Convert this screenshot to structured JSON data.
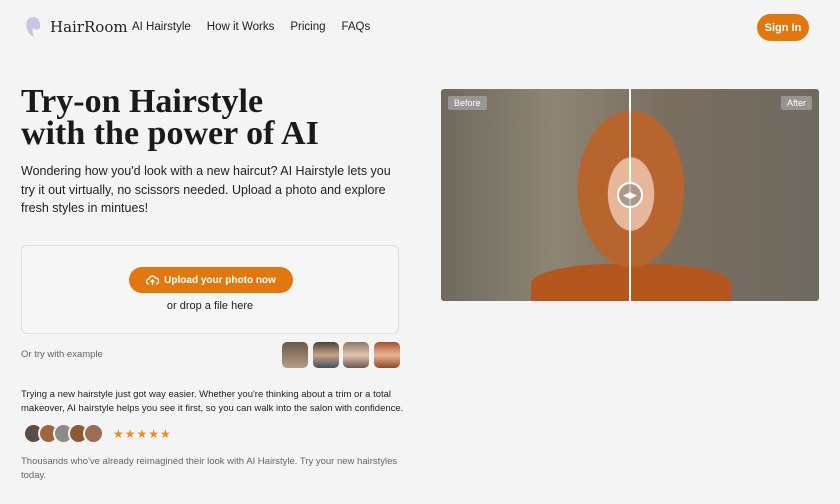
{
  "header": {
    "brand": "HairRoom",
    "nav": [
      "AI Hairstyle",
      "How it Works",
      "Pricing",
      "FAQs"
    ],
    "sign_in": "Sign In"
  },
  "hero": {
    "title_line1": "Try-on Hairstyle",
    "title_line2": "with the power of AI",
    "description": "Wondering how you'd look with a new haircut? AI Hairstyle lets you try it out virtually, no scissors needed. Upload a photo and explore fresh styles in mintues!"
  },
  "upload": {
    "button": "Upload your photo now",
    "drop": "or drop a file here"
  },
  "examples": {
    "label": "Or try with example",
    "count": 4
  },
  "body_text": "Trying a new hairstyle just got way easier. Whether you're thinking about a trim or a total makeover, AI hairstyle helps you see it first, so you can walk into the salon with confidence.",
  "rating": {
    "stars": 5,
    "stars_text": "★★★★★"
  },
  "footer_text": "Thousands who've already reimagined their look with AI Hairstyle. Try your new hairstyles today.",
  "compare": {
    "before": "Before",
    "after": "After"
  },
  "colors": {
    "accent": "#e0780f"
  }
}
